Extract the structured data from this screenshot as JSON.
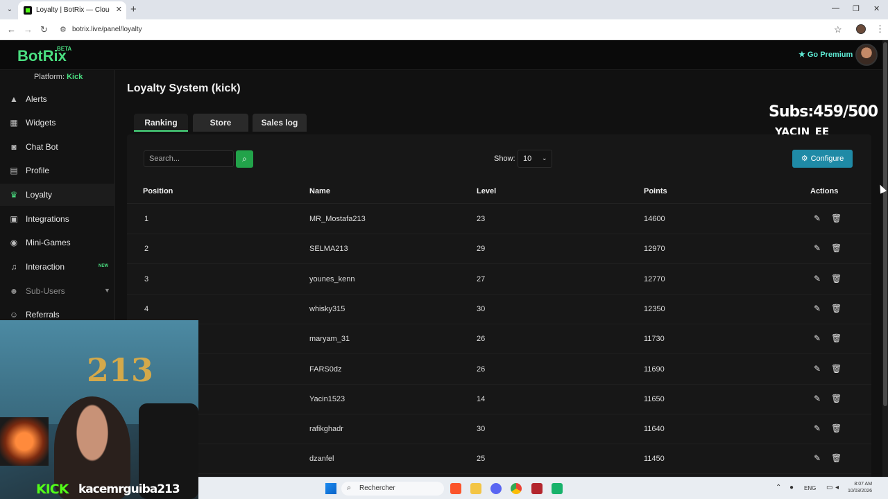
{
  "browser": {
    "tab_title": "Loyalty | BotRix — Cloud Stream",
    "url": "botrix.live/panel/loyalty",
    "new_tab_symbol": "+",
    "close_symbol": "✕"
  },
  "header": {
    "logo": "BotRix",
    "beta": "BETA",
    "premium_label": "Go Premium"
  },
  "sidebar": {
    "platform_label": "Platform:",
    "platform_value": "Kick",
    "items": [
      {
        "label": "Alerts",
        "icon": "warning-icon"
      },
      {
        "label": "Widgets",
        "icon": "grid-icon"
      },
      {
        "label": "Chat Bot",
        "icon": "robot-icon"
      },
      {
        "label": "Profile",
        "icon": "id-card-icon"
      },
      {
        "label": "Loyalty",
        "icon": "trophy-icon",
        "active": true
      },
      {
        "label": "Integrations",
        "icon": "puzzle-icon"
      },
      {
        "label": "Mini-Games",
        "icon": "gamepad-icon"
      },
      {
        "label": "Interaction",
        "icon": "music-icon",
        "badge": "NEW"
      },
      {
        "label": "Sub-Users",
        "icon": "users-icon",
        "muted": true
      },
      {
        "label": "Referrals",
        "icon": "referral-icon"
      }
    ]
  },
  "main": {
    "title": "Loyalty System (kick)",
    "tabs": [
      {
        "label": "Ranking",
        "active": true
      },
      {
        "label": "Store"
      },
      {
        "label": "Sales log"
      }
    ],
    "search_placeholder": "Search...",
    "show_label": "Show:",
    "show_value": "10",
    "configure_label": "Configure"
  },
  "overlay": {
    "subs": "Subs:459/500",
    "name": "YACIN_EE"
  },
  "table": {
    "columns": [
      "Position",
      "Name",
      "Level",
      "Points",
      "Actions"
    ],
    "rows": [
      {
        "position": "1",
        "name": "MR_Mostafa213",
        "level": "23",
        "points": "14600"
      },
      {
        "position": "2",
        "name": "SELMA213",
        "level": "29",
        "points": "12970"
      },
      {
        "position": "3",
        "name": "younes_kenn",
        "level": "27",
        "points": "12770"
      },
      {
        "position": "4",
        "name": "whisky315",
        "level": "30",
        "points": "12350"
      },
      {
        "position": "",
        "name": "maryam_31",
        "level": "26",
        "points": "11730"
      },
      {
        "position": "",
        "name": "FARS0dz",
        "level": "26",
        "points": "11690"
      },
      {
        "position": "",
        "name": "Yacin1523",
        "level": "14",
        "points": "11650"
      },
      {
        "position": "",
        "name": "rafikghadr",
        "level": "30",
        "points": "11640"
      },
      {
        "position": "",
        "name": "dzanfel",
        "level": "25",
        "points": "11450"
      }
    ]
  },
  "webcam": {
    "kick_logo": "KICK",
    "username": "kacemrguiba213",
    "balloon_text": "213"
  },
  "taskbar": {
    "search_label": "Rechercher",
    "lang": "ENG",
    "time": "8:07 AM",
    "date": "10/03/2026"
  }
}
